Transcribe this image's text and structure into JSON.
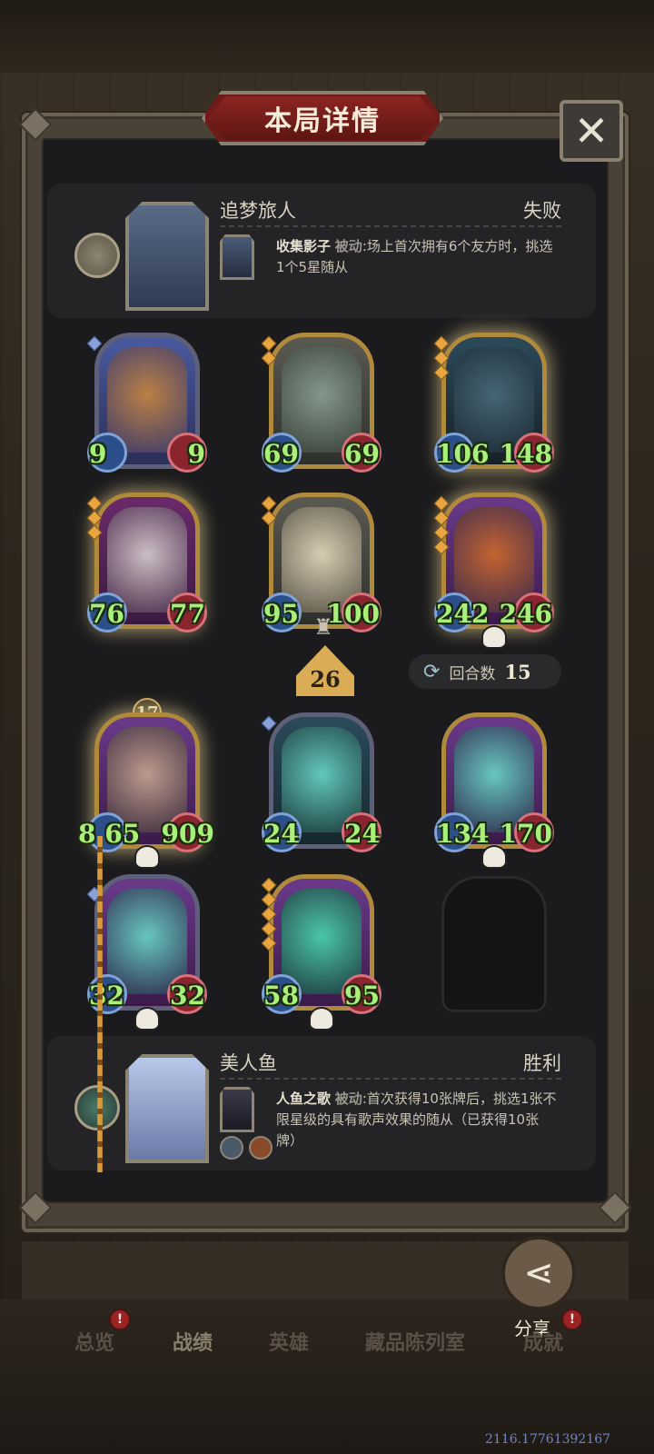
{
  "title": "本局详情",
  "close_icon": "✕",
  "top_player": {
    "name": "追梦旅人",
    "result": "失败",
    "skill_name": "收集影子",
    "skill_tag": "被动",
    "skill_desc": ":场上首次拥有6个友方时，挑选1个5星随从"
  },
  "bottom_player": {
    "name": "美人鱼",
    "result": "胜利",
    "skill_name": "人鱼之歌",
    "skill_tag": "被动",
    "skill_desc": ":首次获得10张牌后，挑选1张不限星级的具有歌声效果的随从（已获得10张牌）"
  },
  "round": {
    "label": "回合数",
    "value": "15",
    "icon": "refresh-icon"
  },
  "tier_value": "26",
  "level_value": "17",
  "top_cards": [
    {
      "atk": "9",
      "hp": "9"
    },
    {
      "atk": "69",
      "hp": "69"
    },
    {
      "atk": "106",
      "hp": "148"
    },
    {
      "atk": "76",
      "hp": "77"
    },
    {
      "atk": "95",
      "hp": "100"
    },
    {
      "atk": "242",
      "hp": "246"
    }
  ],
  "bottom_cards": [
    {
      "atk": "8 65",
      "hp": "909"
    },
    {
      "atk": "24",
      "hp": "24"
    },
    {
      "atk": "134",
      "hp": "170"
    },
    {
      "atk": "32",
      "hp": "32"
    },
    {
      "atk": "58",
      "hp": "95"
    }
  ],
  "share_label": "分享",
  "nav": [
    "总览",
    "战绩",
    "英雄",
    "藏品陈列室",
    "成就"
  ],
  "nav_badge": "!",
  "version": "2116.17761392167"
}
